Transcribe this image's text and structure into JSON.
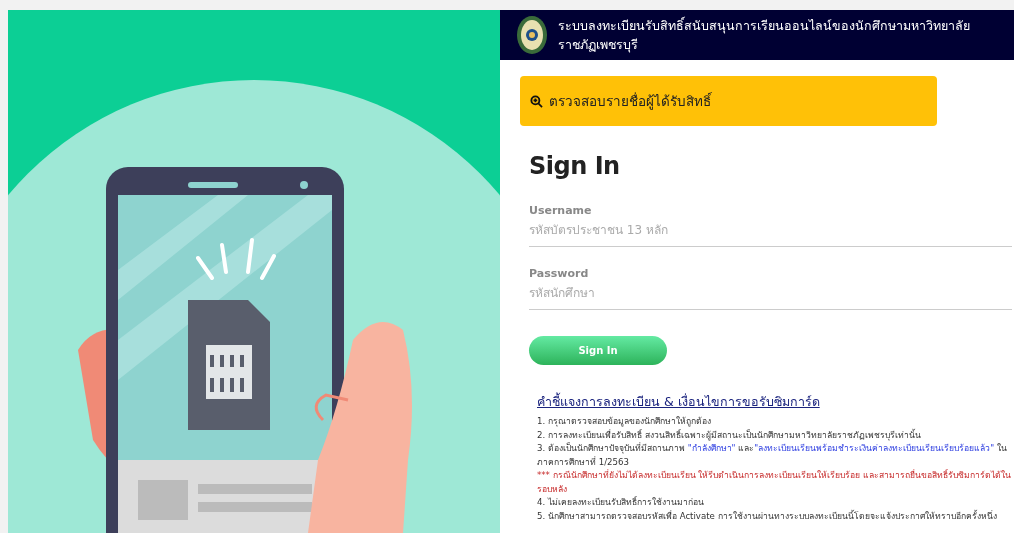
{
  "header": {
    "title": "ระบบลงทะเบียนรับสิทธิ์สนับสนุนการเรียนออนไลน์ของนักศึกษามหาวิทยาลัยราชภัฏเพชรบุรี"
  },
  "check_banner": {
    "label": "ตรวจสอบรายชื่อผู้ได้รับสิทธิ์"
  },
  "sign_in": {
    "title": "Sign In",
    "fields": [
      {
        "label": "Username",
        "placeholder": "รหัสบัตรประชาชน 13 หลัก"
      },
      {
        "label": "Password",
        "placeholder": "รหัสนักศึกษา"
      }
    ],
    "button": "Sign In"
  },
  "instructions": {
    "title": "คำชี้แจงการลงทะเบียน & เงื่อนไขการขอรับซิมการ์ด",
    "items": [
      {
        "kind": "normal",
        "parts": [
          {
            "kind": "plain",
            "text": "1. กรุณาตรวจสอบข้อมูลของนักศึกษาให้ถูกต้อง"
          }
        ]
      },
      {
        "kind": "normal",
        "parts": [
          {
            "kind": "plain",
            "text": "2. การลงทะเบียนเพื่อรับสิทธิ์ สงวนสิทธิ์เฉพาะผู้มีสถานะเป็นนักศึกษามหาวิทยาลัยราชภัฏเพชรบุรีเท่านั้น"
          }
        ]
      },
      {
        "kind": "normal",
        "parts": [
          {
            "kind": "plain",
            "text": "3. ต้องเป็นนักศึกษาปัจจุบันที่มีสถานภาพ "
          },
          {
            "kind": "emphasis",
            "text": "\"กำลังศึกษา\""
          },
          {
            "kind": "plain",
            "text": " และ"
          },
          {
            "kind": "emphasis",
            "text": "\"ลงทะเบียนเรียนพร้อมชำระเงินค่าลงทะเบียนเรียนเรียบร้อยแล้ว\""
          },
          {
            "kind": "plain",
            "text": " ในภาคการศึกษาที่ 1/2563"
          }
        ]
      },
      {
        "kind": "warning",
        "parts": [
          {
            "kind": "plain",
            "text": "*** กรณีนักศึกษาที่ยังไม่ได้ลงทะเบียนเรียน ให้รีบดำเนินการลงทะเบียนเรียนให้เรียบร้อย และสามารถยื่นขอสิทธิ์รับซิมการ์ดได้ในรอบหลัง"
          }
        ]
      },
      {
        "kind": "normal",
        "parts": [
          {
            "kind": "plain",
            "text": "4. ไม่เคยลงทะเบียนรับสิทธิ์การใช้งานมาก่อน"
          }
        ]
      },
      {
        "kind": "normal",
        "parts": [
          {
            "kind": "plain",
            "text": "5. นักศึกษาสามารถตรวจสอบรหัสเพื่อ Activate การใช้งานผ่านทางระบบลงทะเบียนนี้โดยจะแจ้งประกาศให้ทราบอีกครั้งหนึ่ง"
          }
        ]
      }
    ]
  }
}
